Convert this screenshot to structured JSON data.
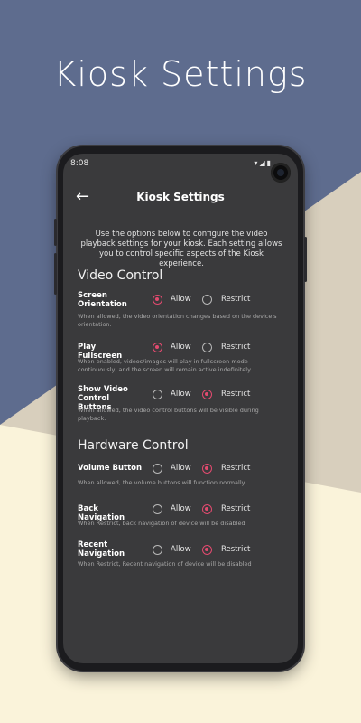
{
  "promo": {
    "title": "Kiosk Settings"
  },
  "status": {
    "time": "8:08",
    "icons": "▾◢▮"
  },
  "appbar": {
    "back_icon": "arrow-left-icon",
    "title": "Kiosk Settings"
  },
  "intro": "Use the options below to configure the video playback settings for your kiosk. Each setting allows you to control specific aspects of the Kiosk experience.",
  "options": {
    "allow": "Allow",
    "restrict": "Restrict"
  },
  "sections": [
    {
      "title": "Video Control",
      "items": [
        {
          "label": "Screen Orientation",
          "selected": "Allow",
          "description": "When allowed, the video orientation changes based on the device's orientation."
        },
        {
          "label": "Play Fullscreen",
          "selected": "Allow",
          "description": "When enabled, videos/images will play in fullscreen mode continuously, and the screen will remain active indefinitely."
        },
        {
          "label": "Show Video Control Buttons",
          "selected": "Restrict",
          "description": "When allowed, the video control buttons will be visible during playback."
        }
      ]
    },
    {
      "title": "Hardware Control",
      "items": [
        {
          "label": "Volume Button",
          "selected": "Restrict",
          "description": "When allowed, the volume buttons will function normally."
        },
        {
          "label": "Back Navigation",
          "selected": "Restrict",
          "description": "When Restrict, back navigation of device will be disabled"
        },
        {
          "label": "Recent Navigation",
          "selected": "Restrict",
          "description": "When Restrict, Recent navigation of device will be disabled"
        }
      ]
    }
  ],
  "colors": {
    "accent": "#e34a6f",
    "screen_bg": "#3a3a3c",
    "backdrop_blue": "#5e6c8e",
    "backdrop_cream": "#faf3da",
    "backdrop_tan": "#d8cfbd"
  }
}
